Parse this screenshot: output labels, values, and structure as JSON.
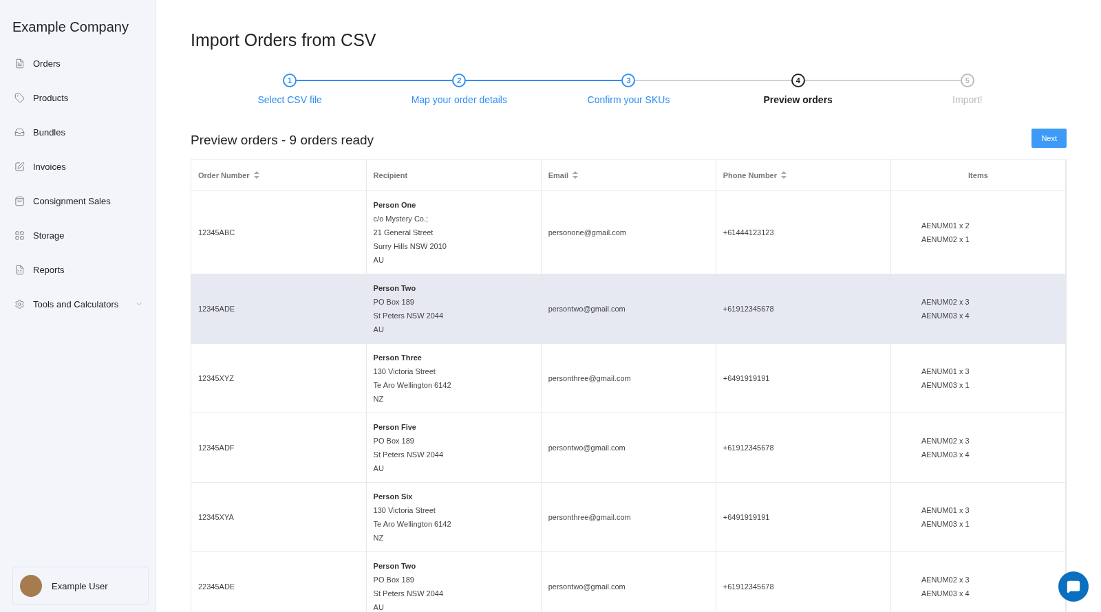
{
  "sidebar": {
    "company": "Example Company",
    "items": [
      {
        "label": "Orders",
        "expandable": false
      },
      {
        "label": "Products",
        "expandable": false
      },
      {
        "label": "Bundles",
        "expandable": false
      },
      {
        "label": "Invoices",
        "expandable": false
      },
      {
        "label": "Consignment Sales",
        "expandable": false
      },
      {
        "label": "Storage",
        "expandable": false
      },
      {
        "label": "Reports",
        "expandable": false
      },
      {
        "label": "Tools and Calculators",
        "expandable": true
      }
    ],
    "user": {
      "name": "Example User"
    }
  },
  "page_title": "Import Orders from CSV",
  "steps": [
    {
      "number": "1",
      "label": "Select CSV file",
      "completed": true,
      "selected": false
    },
    {
      "number": "2",
      "label": "Map your order details",
      "completed": true,
      "selected": false
    },
    {
      "number": "3",
      "label": "Confirm your SKUs",
      "completed": true,
      "selected": false
    },
    {
      "number": "4",
      "label": "Preview orders",
      "completed": false,
      "selected": true
    },
    {
      "number": "5",
      "label": "Import!",
      "completed": false,
      "selected": false
    }
  ],
  "preview": {
    "heading": "Preview orders - 9 orders ready",
    "next_button": "Next"
  },
  "table": {
    "columns": [
      {
        "label": "Order Number",
        "sortable": true
      },
      {
        "label": "Recipient",
        "sortable": false
      },
      {
        "label": "Email",
        "sortable": true
      },
      {
        "label": "Phone Number",
        "sortable": true
      },
      {
        "label": "Items",
        "sortable": false
      }
    ],
    "rows": [
      {
        "order": "12345ABC",
        "recipient_name": "Person One",
        "address": [
          "c/o Mystery Co.;",
          "21 General Street",
          "Surry Hills NSW 2010",
          "AU"
        ],
        "email": "personone@gmail.com",
        "phone": "+61444123123",
        "items": [
          "AENUM01 x 2",
          "AENUM02 x 1"
        ],
        "highlighted": false
      },
      {
        "order": "12345ADE",
        "recipient_name": "Person Two",
        "address": [
          "PO Box 189",
          "St Peters NSW 2044",
          "AU"
        ],
        "email": "persontwo@gmail.com",
        "phone": "+61912345678",
        "items": [
          "AENUM02 x 3",
          "AENUM03 x 4"
        ],
        "highlighted": true
      },
      {
        "order": "12345XYZ",
        "recipient_name": "Person Three",
        "address": [
          "130 Victoria Street",
          "Te Aro Wellington 6142",
          "NZ"
        ],
        "email": "personthree@gmail.com",
        "phone": "+6491919191",
        "items": [
          "AENUM01 x 3",
          "AENUM03 x 1"
        ],
        "highlighted": false
      },
      {
        "order": "12345ADF",
        "recipient_name": "Person Five",
        "address": [
          "PO Box 189",
          "St Peters NSW 2044",
          "AU"
        ],
        "email": "persontwo@gmail.com",
        "phone": "+61912345678",
        "items": [
          "AENUM02 x 3",
          "AENUM03 x 4"
        ],
        "highlighted": false
      },
      {
        "order": "12345XYA",
        "recipient_name": "Person Six",
        "address": [
          "130 Victoria Street",
          "Te Aro Wellington 6142",
          "NZ"
        ],
        "email": "personthree@gmail.com",
        "phone": "+6491919191",
        "items": [
          "AENUM01 x 3",
          "AENUM03 x 1"
        ],
        "highlighted": false
      },
      {
        "order": "22345ADE",
        "recipient_name": "Person Two",
        "address": [
          "PO Box 189",
          "St Peters NSW 2044",
          "AU"
        ],
        "email": "persontwo@gmail.com",
        "phone": "+61912345678",
        "items": [
          "AENUM02 x 3",
          "AENUM03 x 4"
        ],
        "highlighted": false
      }
    ]
  }
}
